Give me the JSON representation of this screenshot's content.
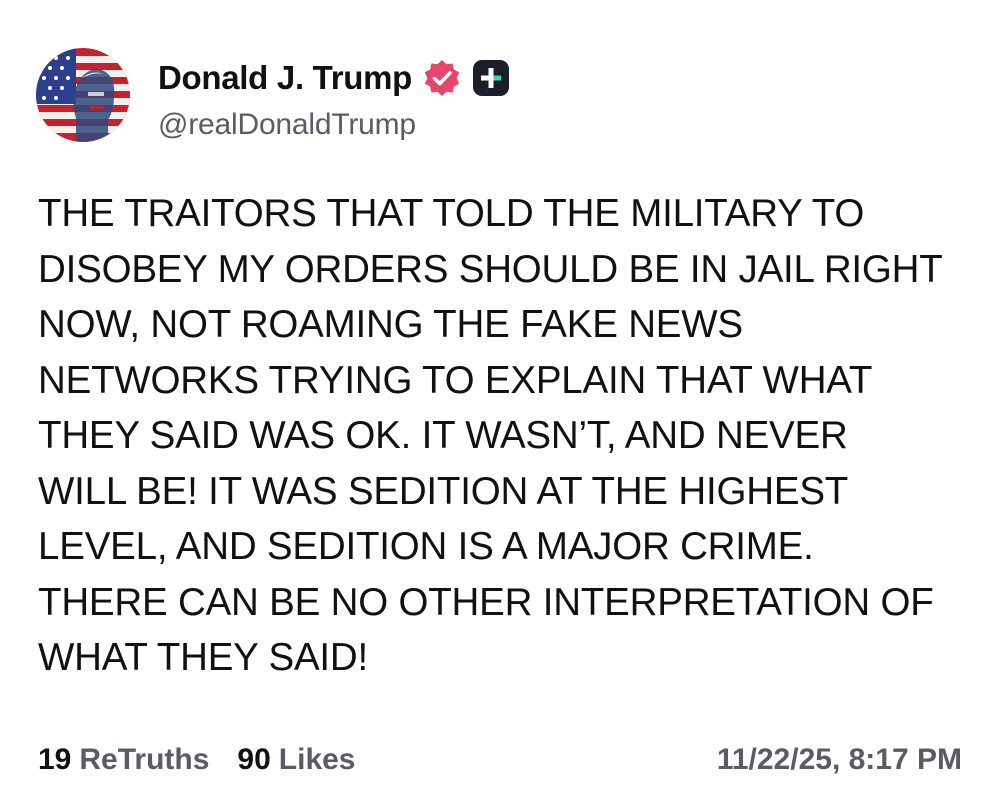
{
  "author": {
    "display_name": "Donald J. Trump",
    "handle": "@realDonaldTrump",
    "verified_color": "#e8456b",
    "badge_icon": "plus-badge-icon",
    "avatar_icon": "avatar-flag-portrait"
  },
  "post": {
    "text_lines": [
      "THE TRAITORS THAT TOLD THE MILITARY TO",
      "DISOBEY MY ORDERS SHOULD BE IN JAIL RIGHT",
      "NOW, NOT ROAMING THE FAKE NEWS",
      "NETWORKS TRYING TO EXPLAIN THAT WHAT",
      "THEY SAID WAS OK. IT WASN’T, AND NEVER",
      "WILL BE! IT WAS SEDITION AT THE HIGHEST",
      "LEVEL, AND SEDITION IS A MAJOR CRIME.",
      "THERE CAN BE NO OTHER INTERPRETATION OF",
      "WHAT THEY SAID!"
    ]
  },
  "stats": {
    "retruths_count": "19",
    "retruths_label": "ReTruths",
    "likes_count": "90",
    "likes_label": "Likes"
  },
  "timestamp": "11/22/25, 8:17 PM",
  "colors": {
    "text": "#111111",
    "muted": "#5b5b66",
    "background": "#ffffff"
  }
}
